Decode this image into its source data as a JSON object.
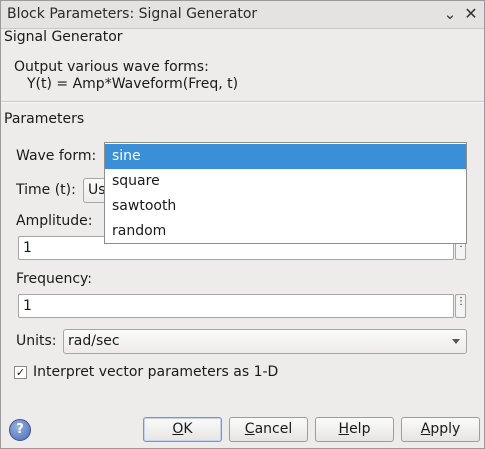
{
  "window": {
    "title": "Block Parameters: Signal Generator",
    "minimize_glyph": "⌄",
    "close_glyph": "✕"
  },
  "block": {
    "name": "Signal Generator",
    "description_line1": "Output various wave forms:",
    "description_line2": "Y(t) = Amp*Waveform(Freq, t)"
  },
  "parameters": {
    "title": "Parameters",
    "wave_form": {
      "label": "Wave form:",
      "options": [
        "sine",
        "square",
        "sawtooth",
        "random"
      ],
      "selected": "sine"
    },
    "time": {
      "label": "Time (t):",
      "value_visible": "Us"
    },
    "amplitude": {
      "label": "Amplitude:",
      "value": "1"
    },
    "frequency": {
      "label": "Frequency:",
      "value": "1"
    },
    "units": {
      "label": "Units:",
      "value": "rad/sec"
    },
    "interpret_vector": {
      "label": "Interpret vector parameters as 1-D",
      "checked": true,
      "check_glyph": "✓"
    },
    "more_glyph": "⋮"
  },
  "buttons": {
    "help_glyph": "?",
    "ok": {
      "underlined": "O",
      "rest": "K"
    },
    "cancel": {
      "underlined": "C",
      "rest": "ancel"
    },
    "help": {
      "underlined": "H",
      "rest": "elp"
    },
    "apply": {
      "underlined": "A",
      "rest": "pply"
    }
  },
  "colors": {
    "selection": "#3a8fd6",
    "dialog_bg": "#edeceb"
  }
}
